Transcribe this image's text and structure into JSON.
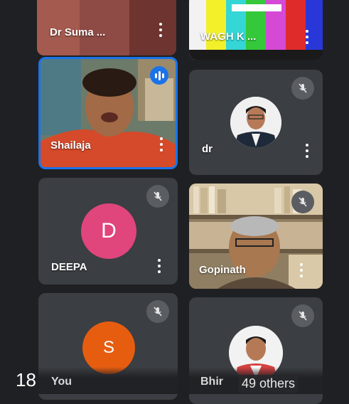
{
  "participants": [
    {
      "name": "Dr Suma ..."
    },
    {
      "name": "WAGH K ..."
    },
    {
      "name": "Shailaja"
    },
    {
      "name": "dr"
    },
    {
      "name": "DEEPA",
      "initial": "D"
    },
    {
      "name": "Gopinath"
    },
    {
      "name": "",
      "initial": "S"
    },
    {
      "name": "Bhir"
    }
  ],
  "footer": {
    "time": "18",
    "you_label": "You",
    "others_label": "49 others"
  },
  "colors": {
    "background": "#1f2023",
    "tile": "#3b3e42",
    "active_speaker_border": "#1a73e8",
    "avatar_pink": "#e0457b",
    "avatar_orange": "#e65d10"
  }
}
